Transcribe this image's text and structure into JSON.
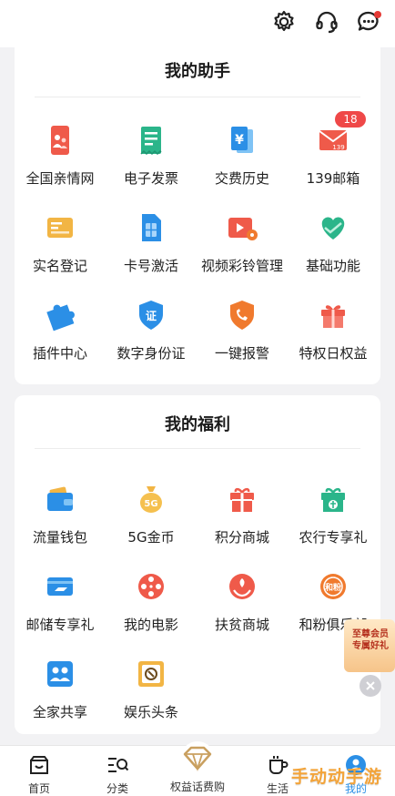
{
  "header": {
    "icons": [
      "gear-icon",
      "headset-icon",
      "message-icon"
    ]
  },
  "assistant": {
    "title": "我的助手",
    "items": [
      {
        "label": "全国亲情网",
        "icon": "family-network-icon"
      },
      {
        "label": "电子发票",
        "icon": "invoice-icon"
      },
      {
        "label": "交费历史",
        "icon": "payment-history-icon"
      },
      {
        "label": "139邮箱",
        "icon": "mail-icon",
        "badge": "18"
      },
      {
        "label": "实名登记",
        "icon": "id-card-icon"
      },
      {
        "label": "卡号激活",
        "icon": "sim-card-icon"
      },
      {
        "label": "视频彩铃管理",
        "icon": "video-ringtone-icon"
      },
      {
        "label": "基础功能",
        "icon": "heart-hand-icon"
      },
      {
        "label": "插件中心",
        "icon": "puzzle-icon"
      },
      {
        "label": "数字身份证",
        "icon": "certificate-icon"
      },
      {
        "label": "一键报警",
        "icon": "alarm-shield-icon"
      },
      {
        "label": "特权日权益",
        "icon": "gift-box-icon"
      }
    ]
  },
  "welfare": {
    "title": "我的福利",
    "items": [
      {
        "label": "流量钱包",
        "icon": "wallet-icon"
      },
      {
        "label": "5G金币",
        "icon": "coin-bag-icon",
        "icon_text": "5G"
      },
      {
        "label": "积分商城",
        "icon": "points-gift-icon"
      },
      {
        "label": "农行专享礼",
        "icon": "bank-gift-icon"
      },
      {
        "label": "邮储专享礼",
        "icon": "post-card-icon"
      },
      {
        "label": "我的电影",
        "icon": "film-reel-icon"
      },
      {
        "label": "扶贫商城",
        "icon": "charity-icon"
      },
      {
        "label": "和粉俱乐部",
        "icon": "club-icon"
      },
      {
        "label": "全家共享",
        "icon": "family-share-icon"
      },
      {
        "label": "娱乐头条",
        "icon": "entertainment-news-icon"
      }
    ]
  },
  "float_ad": {
    "text": "至尊会员 专属好礼"
  },
  "bottom_nav": [
    {
      "label": "首页",
      "icon": "home-icon"
    },
    {
      "label": "分类",
      "icon": "category-icon"
    },
    {
      "label": "权益话费购",
      "icon": "diamond-icon"
    },
    {
      "label": "生活",
      "icon": "cup-icon"
    },
    {
      "label": "我的",
      "icon": "profile-icon"
    }
  ],
  "watermark": "手动动手游",
  "colors": {
    "red": "#ef4848",
    "orange": "#f07a2e",
    "green": "#2bb58a",
    "blue": "#2b8fe6",
    "gold": "#f2b544"
  }
}
